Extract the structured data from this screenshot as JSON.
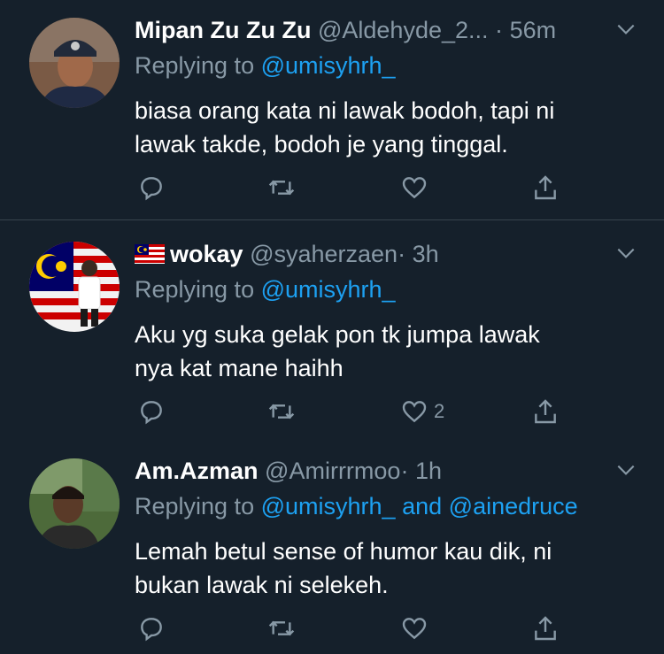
{
  "colors": {
    "background": "#15202b",
    "text": "#ffffff",
    "muted": "#8899a6",
    "link": "#1da1f2",
    "divider": "#38444d"
  },
  "tweets": [
    {
      "name": "Mipan Zu Zu Zu",
      "handle": "@Aldehyde_2...",
      "dot": "·",
      "time": "56m",
      "replying_prefix": "Replying to",
      "replying_to": "@umisyhrh_",
      "replying_and": "",
      "replying_to2": "",
      "text_line1": "biasa orang kata ni lawak bodoh, tapi ni",
      "text_line2": "lawak takde, bodoh je yang tinggal.",
      "like_count": "",
      "avatar": "avatar-photo-icon"
    },
    {
      "name": "wokay",
      "name_emoji": "malaysia-flag-icon",
      "handle": "@syaherzaen",
      "dot": "·",
      "time": "3h",
      "replying_prefix": "Replying to",
      "replying_to": "@umisyhrh_",
      "replying_and": "",
      "replying_to2": "",
      "text_line1": "Aku yg suka gelak pon tk jumpa lawak",
      "text_line2": "nya kat mane haihh",
      "like_count": "2",
      "avatar": "avatar-photo-icon"
    },
    {
      "name": "Am.Azman",
      "handle": "@Amirrrmoo",
      "dot": "·",
      "time": "1h",
      "replying_prefix": "Replying to",
      "replying_to": "@umisyhrh_",
      "replying_and": "and",
      "replying_to2": "@ainedruce",
      "text_line1": "Lemah betul sense of humor kau dik, ni",
      "text_line2": "bukan lawak ni selekeh.",
      "like_count": "",
      "avatar": "avatar-photo-icon"
    }
  ]
}
